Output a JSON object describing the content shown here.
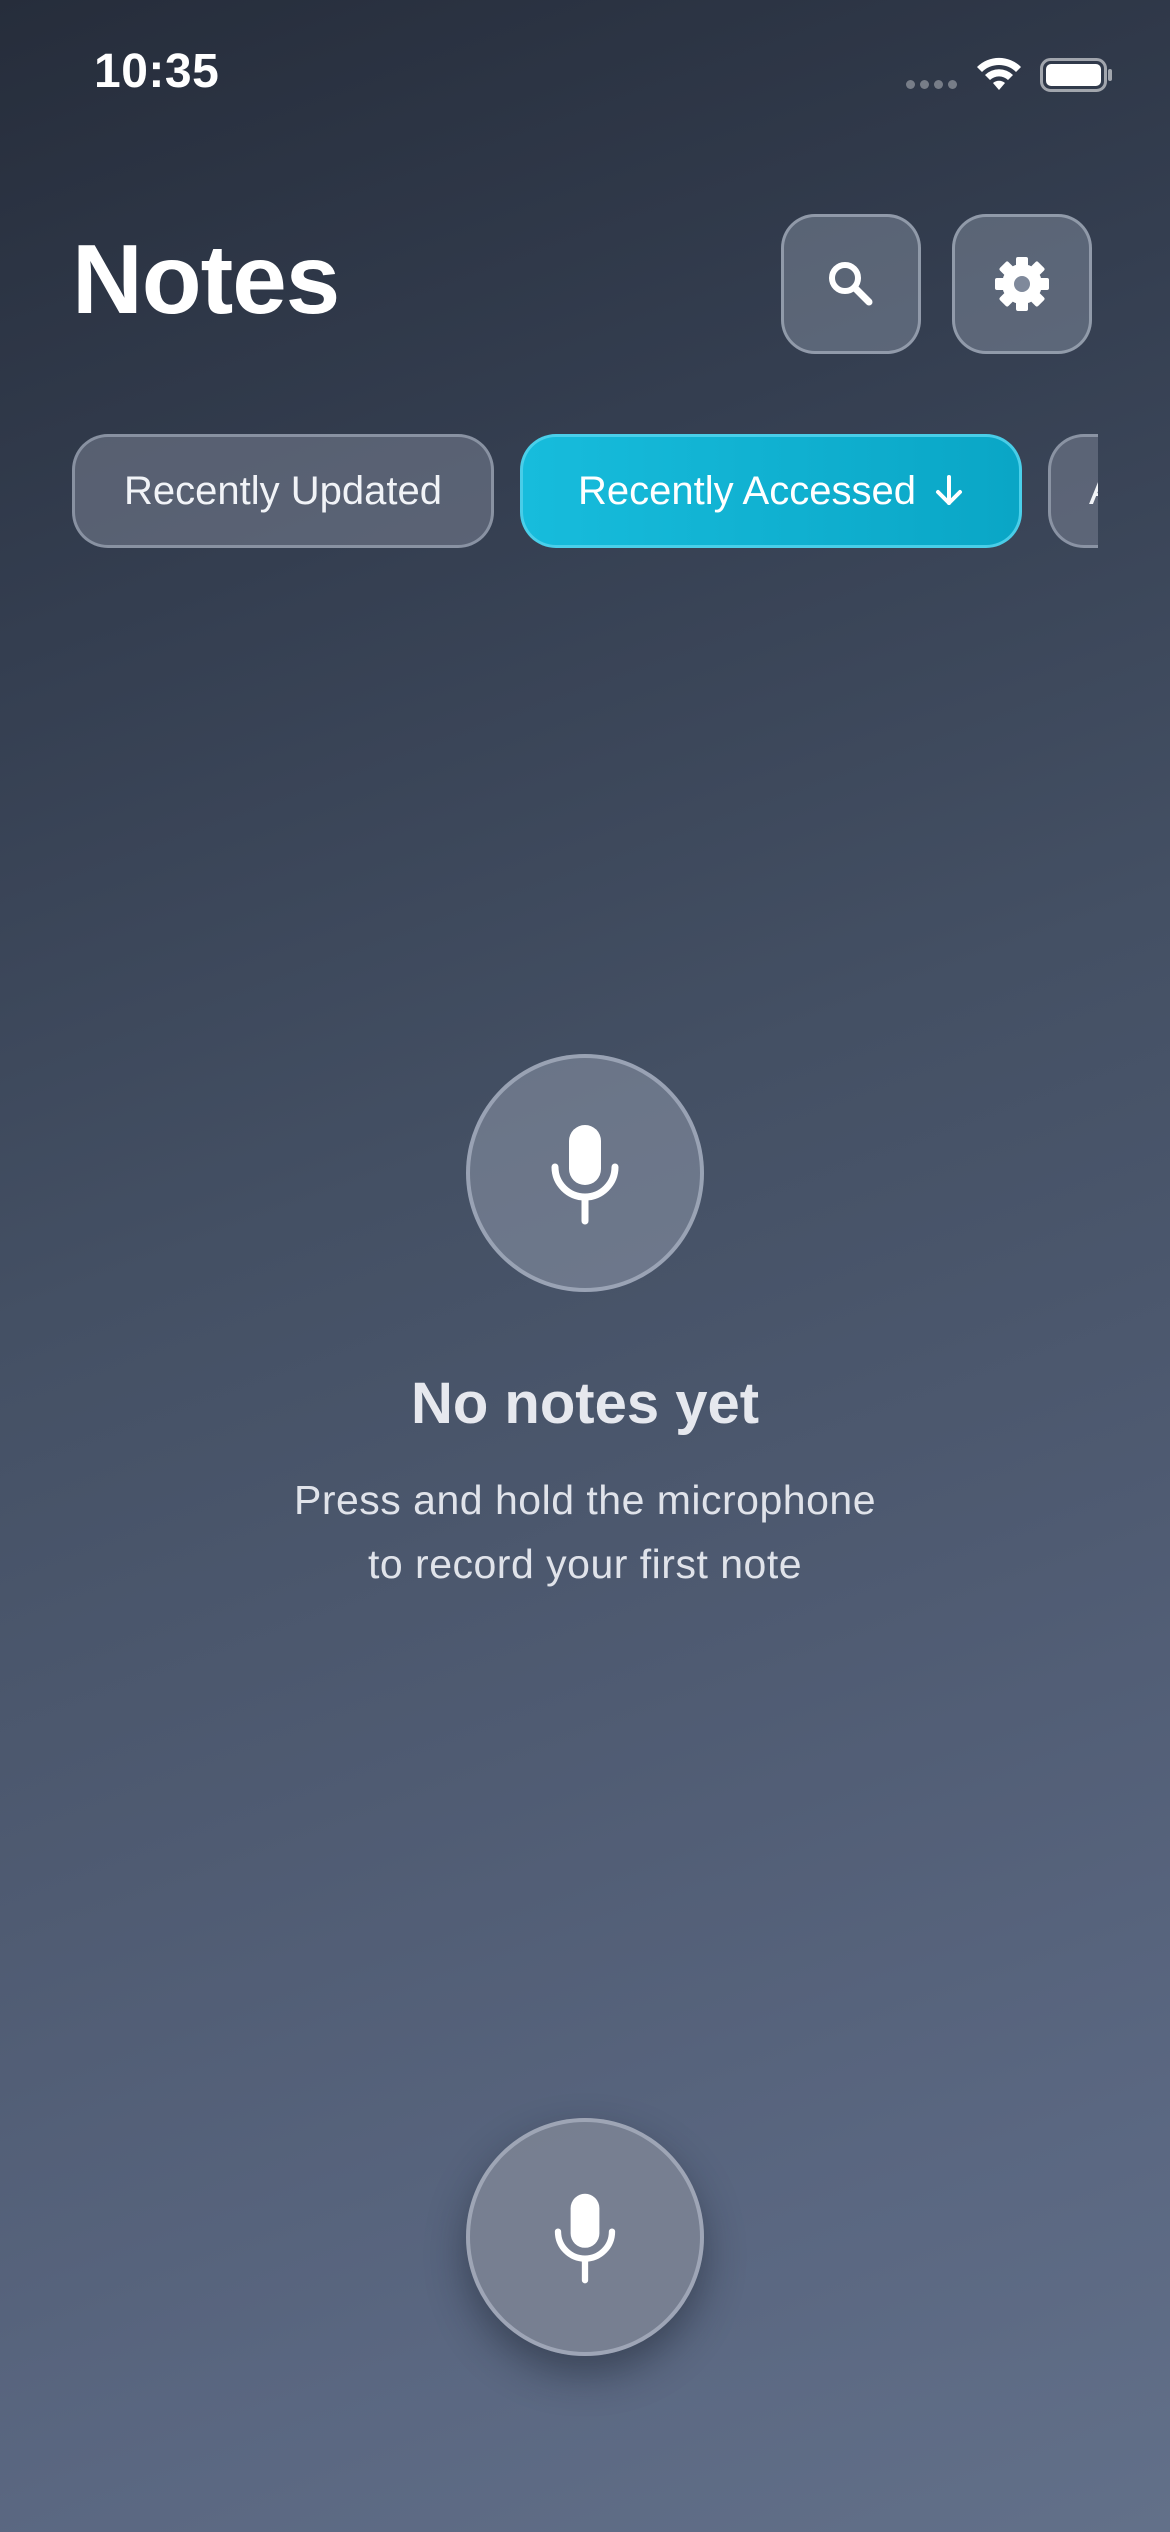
{
  "status_bar": {
    "time": "10:35",
    "icons": [
      "signal-icon",
      "wifi-icon",
      "battery-icon"
    ]
  },
  "header": {
    "title": "Notes",
    "search_icon": "search-icon",
    "settings_icon": "gear-icon"
  },
  "tabs": [
    {
      "label": "Recently Updated",
      "active": false
    },
    {
      "label": "Recently Accessed",
      "active": true,
      "icon": "arrow-down-icon"
    },
    {
      "label": "A",
      "active": false
    }
  ],
  "empty_state": {
    "icon": "microphone-icon",
    "title": "No notes yet",
    "subtitle_line1": "Press and hold the microphone",
    "subtitle_line2": "to record your first note"
  },
  "record_button": {
    "icon": "microphone-icon"
  },
  "colors": {
    "accent": "#12b4d6",
    "background_top": "#262d3b",
    "background_bottom": "#627089",
    "text_primary": "#ffffff",
    "text_secondary": "#e0e3ea"
  }
}
